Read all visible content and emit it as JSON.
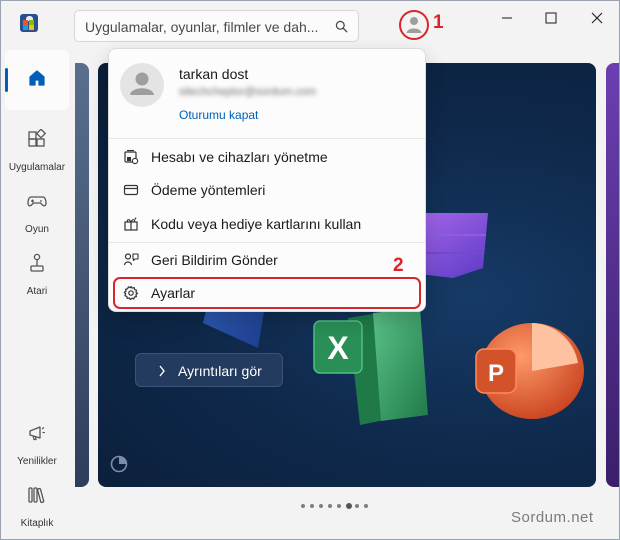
{
  "search": {
    "placeholder": "Uygulamalar, oyunlar, filmler ve dah..."
  },
  "callouts": {
    "first": "1",
    "second": "2"
  },
  "sidebar": {
    "items": [
      {
        "label": "",
        "icon": "home-icon"
      },
      {
        "label": "Uygulamalar",
        "icon": "apps-icon"
      },
      {
        "label": "Oyun",
        "icon": "gamepad-icon"
      },
      {
        "label": "Atari",
        "icon": "joystick-icon"
      },
      {
        "label": "Yenilikler",
        "icon": "megaphone-icon"
      },
      {
        "label": "Kitaplık",
        "icon": "library-icon"
      }
    ]
  },
  "account_menu": {
    "user_name": "tarkan dost",
    "user_email": "sitechcheptor@sordum.com",
    "signout": "Oturumu kapat",
    "items": [
      {
        "label": "Hesabı ve cihazları yönetme",
        "icon": "device-manage-icon"
      },
      {
        "label": "Ödeme yöntemleri",
        "icon": "credit-card-icon"
      },
      {
        "label": "Kodu veya hediye kartlarını kullan",
        "icon": "gift-card-icon"
      },
      {
        "label": "Geri Bildirim Gönder",
        "icon": "feedback-icon"
      },
      {
        "label": "Ayarlar",
        "icon": "gear-icon"
      }
    ]
  },
  "hero": {
    "details_button": "Ayrıntıları gör"
  },
  "carousel": {
    "count": 8,
    "active_index": 5
  },
  "watermark": "Sordum.net",
  "colors": {
    "accent": "#005fb8",
    "highlight": "#d9262c"
  }
}
